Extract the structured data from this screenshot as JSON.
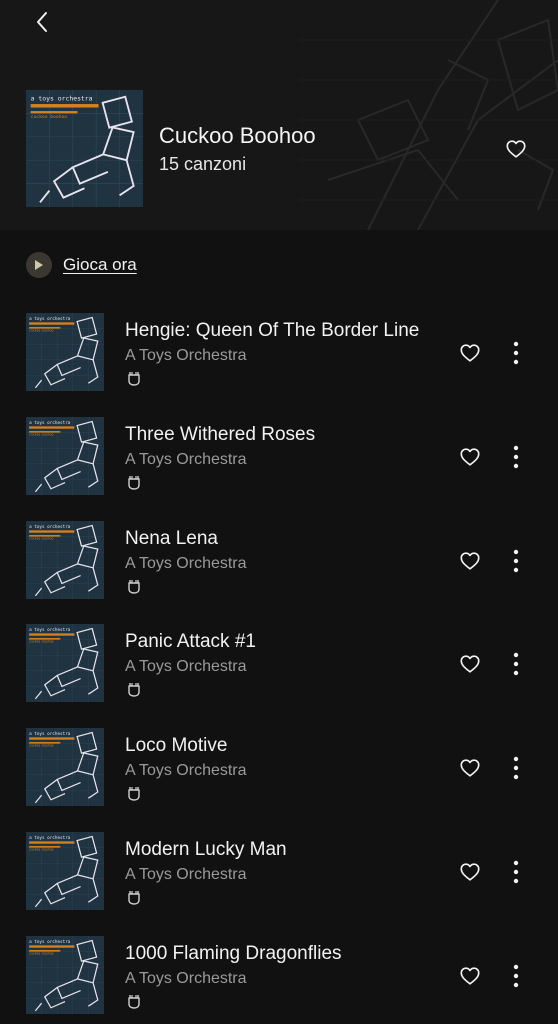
{
  "header": {
    "album_title": "Cuckoo Boohoo",
    "track_count": "15 canzoni",
    "cover_band_text": "a toys orchestra",
    "cover_album_text": "cuckoo boohoo"
  },
  "actions": {
    "play_label": "Gioca ora"
  },
  "colors": {
    "background": "#111111",
    "header_bg": "#171717",
    "cover_bg": "#1f3340",
    "cover_accent": "#d6801f",
    "secondary_text": "#9a9a9a"
  },
  "tracks": [
    {
      "title": "Hengie: Queen Of The Border Line",
      "artist": "A Toys Orchestra"
    },
    {
      "title": "Three Withered Roses",
      "artist": "A Toys Orchestra"
    },
    {
      "title": "Nena Lena",
      "artist": "A Toys Orchestra"
    },
    {
      "title": "Panic Attack #1",
      "artist": "A Toys Orchestra"
    },
    {
      "title": "Loco Motive",
      "artist": "A Toys Orchestra"
    },
    {
      "title": "Modern Lucky Man",
      "artist": "A Toys Orchestra"
    },
    {
      "title": "1000 Flaming Dragonflies",
      "artist": "A Toys Orchestra"
    }
  ]
}
